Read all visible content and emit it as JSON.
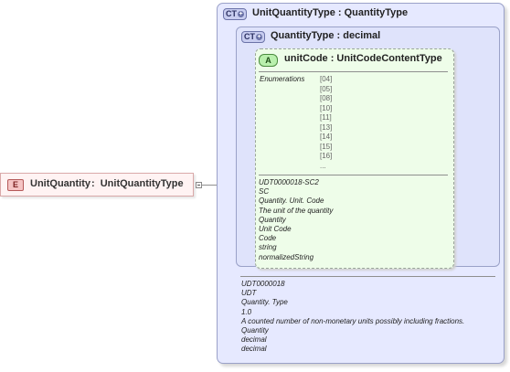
{
  "element": {
    "badge": "E",
    "name": "UnitQuantity",
    "separator": ":",
    "type": "UnitQuantityType"
  },
  "outer_type": {
    "badge": "CT",
    "title": "UnitQuantityType : QuantityType",
    "documentation": [
      "UDT0000018",
      "UDT",
      "Quantity. Type",
      "1.0",
      "A counted number of non-monetary units possibly including fractions.",
      "Quantity",
      "decimal",
      "decimal"
    ]
  },
  "inner_type": {
    "badge": "CT",
    "title": "QuantityType : decimal"
  },
  "attribute": {
    "badge": "A",
    "title": "unitCode : UnitCodeContentType",
    "enumerations_label": "Enumerations",
    "enumerations": [
      "[04]",
      "[05]",
      "[08]",
      "[10]",
      "[11]",
      "[13]",
      "[14]",
      "[15]",
      "[16]",
      "..."
    ],
    "documentation": [
      "UDT0000018-SC2",
      "SC",
      "Quantity. Unit. Code",
      "The unit of the quantity",
      "Quantity",
      "Unit Code",
      "Code",
      "string",
      "normalizedString"
    ]
  }
}
